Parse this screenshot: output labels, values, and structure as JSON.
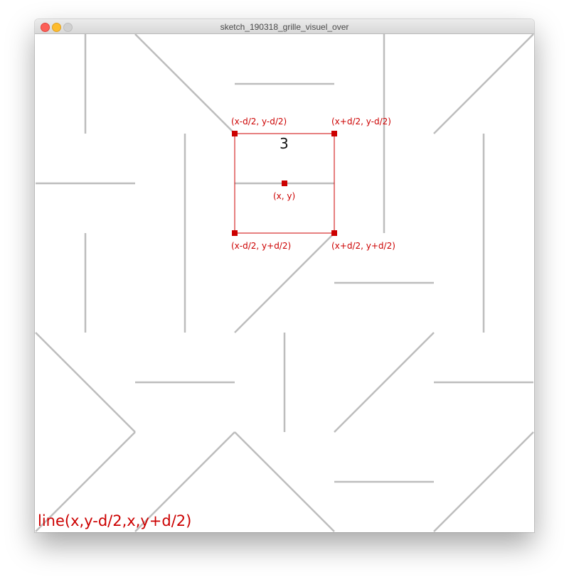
{
  "window": {
    "title": "sketch_190318_grille_visuel_over"
  },
  "canvas": {
    "cell_number": "3",
    "labels": {
      "top_left": "(x-d/2, y-d/2)",
      "top_right": "(x+d/2, y-d/2)",
      "center": "(x, y)",
      "bottom_left": "(x-d/2, y+d/2)",
      "bottom_right": "(x+d/2, y+d/2)"
    },
    "code_line": "line(x,y-d/2,x,y+d/2)"
  },
  "colors": {
    "accent": "#cc0000",
    "grid_line": "#bdbdbd",
    "text": "#111111"
  }
}
